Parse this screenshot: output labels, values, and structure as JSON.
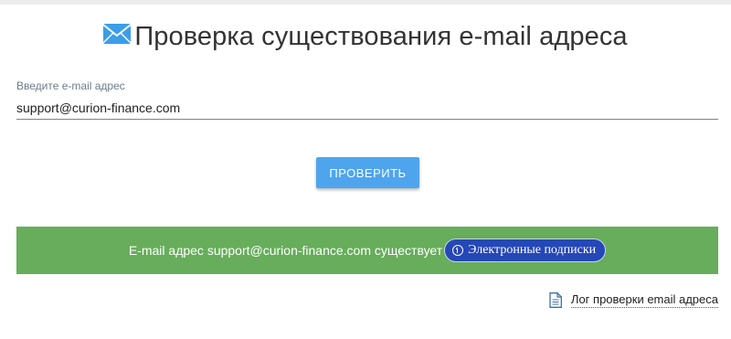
{
  "header": {
    "title": "Проверка существования e-mail адреса",
    "icon": "envelope-icon"
  },
  "form": {
    "label": "Введите e-mail адрес",
    "email_value": "support@curion-finance.com",
    "check_button_label": "ПРОВЕРИТЬ"
  },
  "result": {
    "message": "E-mail адрес support@curion-finance.com существует",
    "subscriptions_button_label": "Электронные подписки",
    "subscriptions_icon": "arrow-up-circle-icon",
    "color": "#67ad5b"
  },
  "footer": {
    "log_link_label": "Лог проверки email адреса",
    "log_icon": "document-icon"
  },
  "colors": {
    "accent": "#4ea5ee",
    "success": "#67ad5b",
    "subscriptions": "#2547b8"
  }
}
